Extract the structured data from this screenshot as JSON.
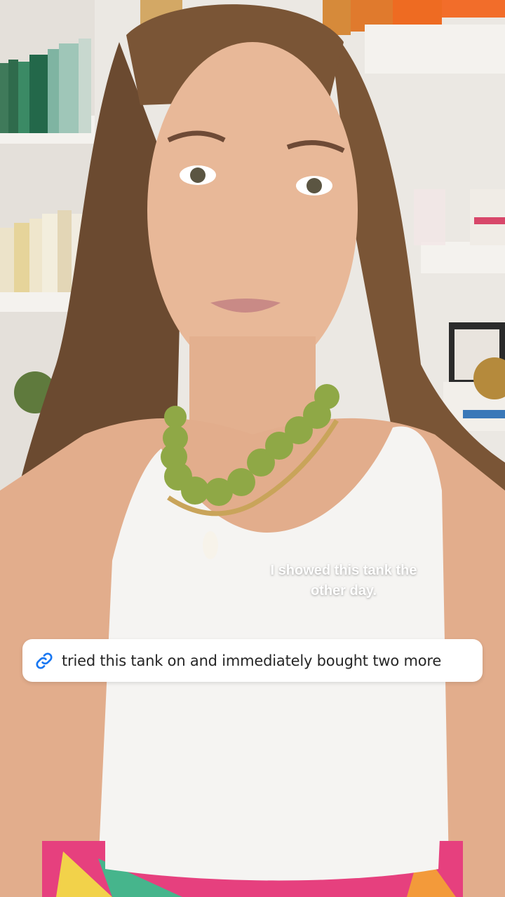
{
  "story": {
    "caption_lines": [
      "I showed this tank the",
      "other day."
    ],
    "link_sticker": {
      "icon": "link-icon",
      "text": "tried this tank on and immediately bought two more",
      "icon_color": "#1877f2"
    }
  }
}
